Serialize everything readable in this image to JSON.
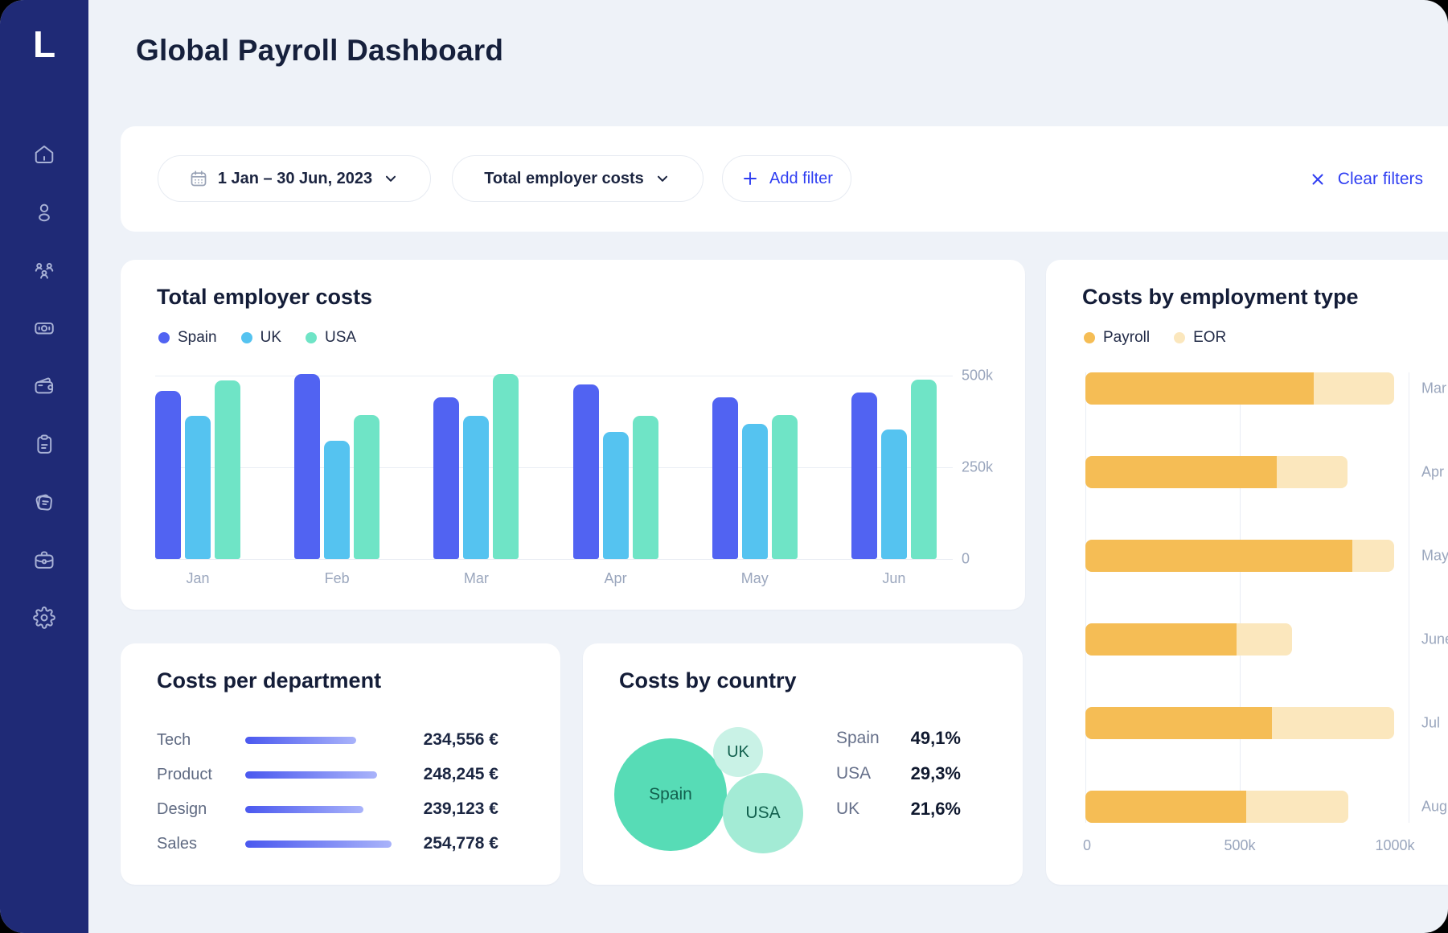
{
  "app": {
    "logo_letter": "L",
    "page_title": "Global Payroll Dashboard"
  },
  "sidebar": {
    "items": [
      {
        "icon": "home-icon"
      },
      {
        "icon": "user-icon"
      },
      {
        "icon": "team-icon"
      },
      {
        "icon": "payments-icon"
      },
      {
        "icon": "wallet-icon"
      },
      {
        "icon": "clipboard-icon"
      },
      {
        "icon": "receipts-icon"
      },
      {
        "icon": "briefcase-icon"
      },
      {
        "icon": "settings-icon"
      }
    ]
  },
  "filter_bar": {
    "date_range": "1 Jan – 30 Jun, 2023",
    "metric": "Total employer costs",
    "add_filter_label": "Add filter",
    "clear_filters_label": "Clear filters"
  },
  "colors": {
    "sidebar": "#1f2a76",
    "accent_blue": "#2f3ef2",
    "spain": "#5163f2",
    "uk": "#55c3f0",
    "usa": "#6fe4c6",
    "payroll": "#f5bd55",
    "eor": "#fbe7bd",
    "bubble_spain": "#57dcb6",
    "bubble_usa": "#a3ebd5",
    "bubble_uk": "#c9f2e6"
  },
  "chart_data": [
    {
      "id": "total_employer_costs",
      "type": "bar",
      "title": "Total employer costs",
      "categories": [
        "Jan",
        "Feb",
        "Mar",
        "Apr",
        "May",
        "Jun"
      ],
      "series": [
        {
          "name": "Spain",
          "color": "#5163f2",
          "values": [
            458000,
            505000,
            440000,
            476000,
            441000,
            455000
          ]
        },
        {
          "name": "UK",
          "color": "#55c3f0",
          "values": [
            390000,
            322000,
            391000,
            347000,
            368000,
            354000
          ]
        },
        {
          "name": "USA",
          "color": "#6fe4c6",
          "values": [
            487000,
            392000,
            505000,
            391000,
            392000,
            490000
          ]
        }
      ],
      "y_ticks": [
        "0",
        "250k",
        "500k"
      ],
      "ylim": [
        0,
        500000
      ],
      "grid": "horizontal",
      "legend_position": "top-left"
    },
    {
      "id": "costs_by_employment_type",
      "type": "bar",
      "orientation": "horizontal-stacked",
      "title": "Costs by employment type",
      "categories": [
        "Mar",
        "Apr",
        "May",
        "June",
        "Jul",
        "Aug"
      ],
      "series": [
        {
          "name": "Payroll",
          "color": "#f5bd55",
          "values": [
            740000,
            620000,
            865000,
            490000,
            605000,
            520000
          ]
        },
        {
          "name": "EOR",
          "color": "#fbe7bd",
          "values": [
            260000,
            230000,
            135000,
            180000,
            395000,
            330000
          ]
        }
      ],
      "x_ticks": [
        "0",
        "500k",
        "1000k"
      ],
      "xlim": [
        0,
        1000000
      ],
      "grid": "vertical",
      "legend_position": "top-left"
    },
    {
      "id": "costs_per_department",
      "type": "bar",
      "orientation": "horizontal",
      "title": "Costs per department",
      "rows": [
        {
          "label": "Tech",
          "value": 234556,
          "value_label": "234,556 €",
          "bar_pct": 76
        },
        {
          "label": "Product",
          "value": 248245,
          "value_label": "248,245 €",
          "bar_pct": 90
        },
        {
          "label": "Design",
          "value": 239123,
          "value_label": "239,123 €",
          "bar_pct": 81
        },
        {
          "label": "Sales",
          "value": 254778,
          "value_label": "254,778 €",
          "bar_pct": 100
        }
      ]
    },
    {
      "id": "costs_by_country",
      "type": "bubble",
      "title": "Costs by country",
      "bubbles": [
        {
          "label": "Spain",
          "share_pct": 49.1,
          "color": "#57dcb6"
        },
        {
          "label": "UK",
          "share_pct": 21.6,
          "color": "#c9f2e6"
        },
        {
          "label": "USA",
          "share_pct": 29.3,
          "color": "#a3ebd5"
        }
      ],
      "stats": [
        {
          "label": "Spain",
          "value": "49,1%"
        },
        {
          "label": "USA",
          "value": "29,3%"
        },
        {
          "label": "UK",
          "value": "21,6%"
        }
      ]
    }
  ]
}
